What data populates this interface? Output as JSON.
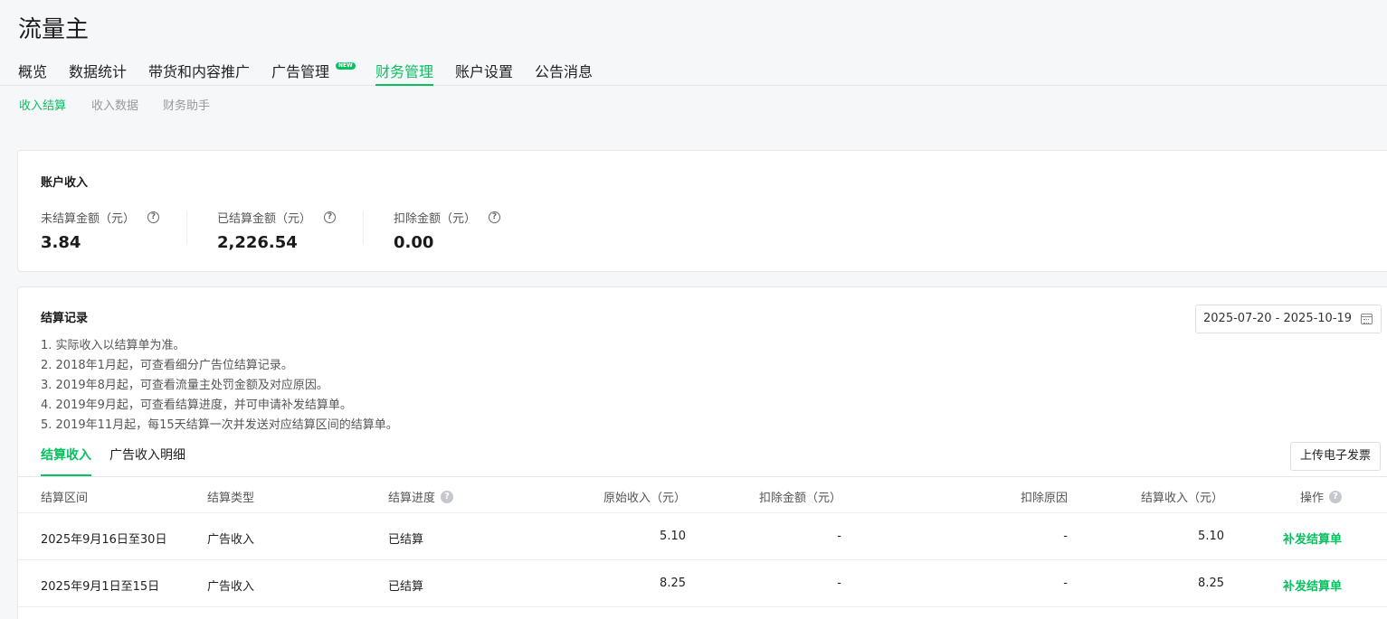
{
  "app": {
    "title": "流量主"
  },
  "main_nav": {
    "items": [
      "概览",
      "数据统计",
      "带货和内容推广",
      "广告管理",
      "财务管理",
      "账户设置",
      "公告消息"
    ],
    "active": "财务管理",
    "new_badge": "NEW"
  },
  "sub_nav": {
    "items": [
      "收入结算",
      "收入数据",
      "财务助手"
    ],
    "active": "收入结算"
  },
  "account_income": {
    "title": "账户收入",
    "stats": [
      {
        "label": "未结算金额（元）",
        "value": "3.84"
      },
      {
        "label": "已结算金额（元）",
        "value": "2,226.54"
      },
      {
        "label": "扣除金额（元）",
        "value": "0.00"
      }
    ],
    "help_icon": "question-circle-icon"
  },
  "settlement": {
    "title": "结算记录",
    "date_range": "2025-07-20 - 2025-10-19",
    "notes": [
      "1. 实际收入以结算单为准。",
      "2. 2018年1月起，可查看细分广告位结算记录。",
      "3. 2019年8月起，可查看流量主处罚金额及对应原因。",
      "4. 2019年9月起，可查看结算进度，并可申请补发结算单。",
      "5. 2019年11月起，每15天结算一次并发送对应结算区间的结算单。"
    ],
    "tabs": [
      "结算收入",
      "广告收入明细"
    ],
    "active_tab": "结算收入",
    "upload_button": "上传电子发票",
    "columns": [
      "结算区间",
      "结算类型",
      "结算进度",
      "原始收入（元）",
      "扣除金额（元）",
      "扣除原因",
      "结算收入（元）",
      "操作"
    ],
    "rows": [
      {
        "period": "2025年9月16日至30日",
        "type": "广告收入",
        "progress": "已结算",
        "original": "5.10",
        "deduction": "-",
        "reason": "-",
        "income": "5.10",
        "action": "补发结算单"
      },
      {
        "period": "2025年9月1日至15日",
        "type": "广告收入",
        "progress": "已结算",
        "original": "8.25",
        "deduction": "-",
        "reason": "-",
        "income": "8.25",
        "action": "补发结算单"
      }
    ]
  },
  "colors": {
    "accent": "#07c160",
    "background": "#f6f7f9"
  }
}
